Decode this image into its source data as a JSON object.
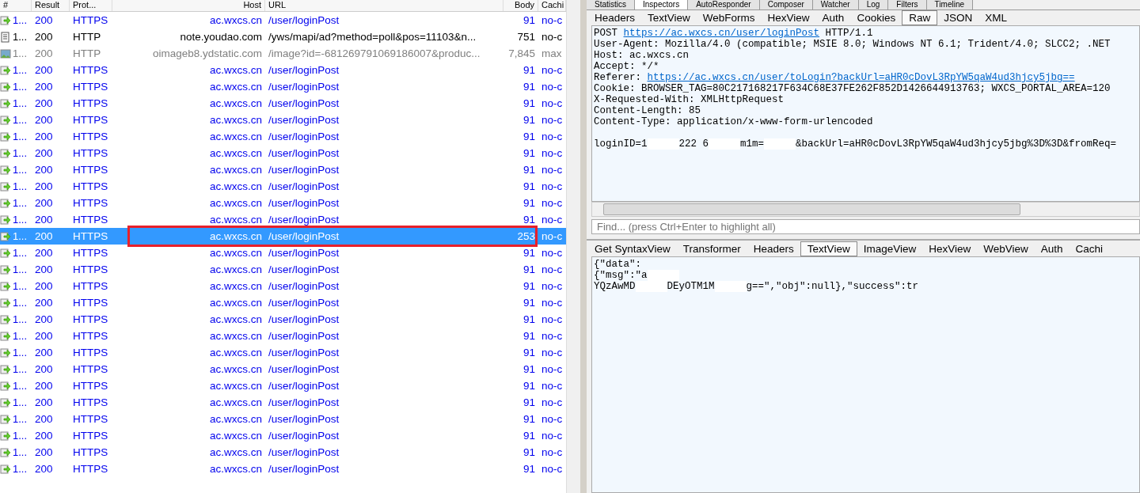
{
  "sessions": {
    "columns": [
      "#",
      "Result",
      "Prot...",
      "Host",
      "URL",
      "Body",
      "Cachi"
    ],
    "rows": [
      {
        "kind": "https",
        "num": "1...",
        "result": "200",
        "protocol": "HTTPS",
        "host": "ac.wxcs.cn",
        "url": "/user/loginPost",
        "body": "91",
        "caching": "no-c",
        "selected": false
      },
      {
        "kind": "html",
        "num": "1...",
        "result": "200",
        "protocol": "HTTP",
        "host": "note.youdao.com",
        "url": "/yws/mapi/ad?method=poll&pos=11103&n...",
        "body": "751",
        "caching": "no-c",
        "selected": false
      },
      {
        "kind": "image",
        "num": "1...",
        "result": "200",
        "protocol": "HTTP",
        "host": "oimageb8.ydstatic.com",
        "url": "/image?id=-681269791069186007&produc...",
        "body": "7,845",
        "caching": "max",
        "selected": false
      },
      {
        "kind": "https",
        "num": "1...",
        "result": "200",
        "protocol": "HTTPS",
        "host": "ac.wxcs.cn",
        "url": "/user/loginPost",
        "body": "91",
        "caching": "no-c",
        "selected": false
      },
      {
        "kind": "https",
        "num": "1...",
        "result": "200",
        "protocol": "HTTPS",
        "host": "ac.wxcs.cn",
        "url": "/user/loginPost",
        "body": "91",
        "caching": "no-c",
        "selected": false
      },
      {
        "kind": "https",
        "num": "1...",
        "result": "200",
        "protocol": "HTTPS",
        "host": "ac.wxcs.cn",
        "url": "/user/loginPost",
        "body": "91",
        "caching": "no-c",
        "selected": false
      },
      {
        "kind": "https",
        "num": "1...",
        "result": "200",
        "protocol": "HTTPS",
        "host": "ac.wxcs.cn",
        "url": "/user/loginPost",
        "body": "91",
        "caching": "no-c",
        "selected": false
      },
      {
        "kind": "https",
        "num": "1...",
        "result": "200",
        "protocol": "HTTPS",
        "host": "ac.wxcs.cn",
        "url": "/user/loginPost",
        "body": "91",
        "caching": "no-c",
        "selected": false
      },
      {
        "kind": "https",
        "num": "1...",
        "result": "200",
        "protocol": "HTTPS",
        "host": "ac.wxcs.cn",
        "url": "/user/loginPost",
        "body": "91",
        "caching": "no-c",
        "selected": false
      },
      {
        "kind": "https",
        "num": "1...",
        "result": "200",
        "protocol": "HTTPS",
        "host": "ac.wxcs.cn",
        "url": "/user/loginPost",
        "body": "91",
        "caching": "no-c",
        "selected": false
      },
      {
        "kind": "https",
        "num": "1...",
        "result": "200",
        "protocol": "HTTPS",
        "host": "ac.wxcs.cn",
        "url": "/user/loginPost",
        "body": "91",
        "caching": "no-c",
        "selected": false
      },
      {
        "kind": "https",
        "num": "1...",
        "result": "200",
        "protocol": "HTTPS",
        "host": "ac.wxcs.cn",
        "url": "/user/loginPost",
        "body": "91",
        "caching": "no-c",
        "selected": false
      },
      {
        "kind": "https",
        "num": "1...",
        "result": "200",
        "protocol": "HTTPS",
        "host": "ac.wxcs.cn",
        "url": "/user/loginPost",
        "body": "91",
        "caching": "no-c",
        "selected": false
      },
      {
        "kind": "https",
        "num": "1...",
        "result": "200",
        "protocol": "HTTPS",
        "host": "ac.wxcs.cn",
        "url": "/user/loginPost",
        "body": "253",
        "caching": "no-c",
        "selected": true
      },
      {
        "kind": "https",
        "num": "1...",
        "result": "200",
        "protocol": "HTTPS",
        "host": "ac.wxcs.cn",
        "url": "/user/loginPost",
        "body": "91",
        "caching": "no-c",
        "selected": false
      },
      {
        "kind": "https",
        "num": "1...",
        "result": "200",
        "protocol": "HTTPS",
        "host": "ac.wxcs.cn",
        "url": "/user/loginPost",
        "body": "91",
        "caching": "no-c",
        "selected": false
      },
      {
        "kind": "https",
        "num": "1...",
        "result": "200",
        "protocol": "HTTPS",
        "host": "ac.wxcs.cn",
        "url": "/user/loginPost",
        "body": "91",
        "caching": "no-c",
        "selected": false
      },
      {
        "kind": "https",
        "num": "1...",
        "result": "200",
        "protocol": "HTTPS",
        "host": "ac.wxcs.cn",
        "url": "/user/loginPost",
        "body": "91",
        "caching": "no-c",
        "selected": false
      },
      {
        "kind": "https",
        "num": "1...",
        "result": "200",
        "protocol": "HTTPS",
        "host": "ac.wxcs.cn",
        "url": "/user/loginPost",
        "body": "91",
        "caching": "no-c",
        "selected": false
      },
      {
        "kind": "https",
        "num": "1...",
        "result": "200",
        "protocol": "HTTPS",
        "host": "ac.wxcs.cn",
        "url": "/user/loginPost",
        "body": "91",
        "caching": "no-c",
        "selected": false
      },
      {
        "kind": "https",
        "num": "1...",
        "result": "200",
        "protocol": "HTTPS",
        "host": "ac.wxcs.cn",
        "url": "/user/loginPost",
        "body": "91",
        "caching": "no-c",
        "selected": false
      },
      {
        "kind": "https",
        "num": "1...",
        "result": "200",
        "protocol": "HTTPS",
        "host": "ac.wxcs.cn",
        "url": "/user/loginPost",
        "body": "91",
        "caching": "no-c",
        "selected": false
      },
      {
        "kind": "https",
        "num": "1...",
        "result": "200",
        "protocol": "HTTPS",
        "host": "ac.wxcs.cn",
        "url": "/user/loginPost",
        "body": "91",
        "caching": "no-c",
        "selected": false
      },
      {
        "kind": "https",
        "num": "1...",
        "result": "200",
        "protocol": "HTTPS",
        "host": "ac.wxcs.cn",
        "url": "/user/loginPost",
        "body": "91",
        "caching": "no-c",
        "selected": false
      },
      {
        "kind": "https",
        "num": "1...",
        "result": "200",
        "protocol": "HTTPS",
        "host": "ac.wxcs.cn",
        "url": "/user/loginPost",
        "body": "91",
        "caching": "no-c",
        "selected": false
      },
      {
        "kind": "https",
        "num": "1...",
        "result": "200",
        "protocol": "HTTPS",
        "host": "ac.wxcs.cn",
        "url": "/user/loginPost",
        "body": "91",
        "caching": "no-c",
        "selected": false
      },
      {
        "kind": "https",
        "num": "1...",
        "result": "200",
        "protocol": "HTTPS",
        "host": "ac.wxcs.cn",
        "url": "/user/loginPost",
        "body": "91",
        "caching": "no-c",
        "selected": false
      },
      {
        "kind": "https",
        "num": "1...",
        "result": "200",
        "protocol": "HTTPS",
        "host": "ac.wxcs.cn",
        "url": "/user/loginPost",
        "body": "91",
        "caching": "no-c",
        "selected": false
      }
    ]
  },
  "main_tabs": [
    {
      "label": "Statistics",
      "selected": false
    },
    {
      "label": "Inspectors",
      "selected": true
    },
    {
      "label": "AutoResponder",
      "selected": false
    },
    {
      "label": "Composer",
      "selected": false
    },
    {
      "label": "Watcher",
      "selected": false
    },
    {
      "label": "Log",
      "selected": false
    },
    {
      "label": "Filters",
      "selected": false
    },
    {
      "label": "Timeline",
      "selected": false
    }
  ],
  "request": {
    "tabs": [
      {
        "label": "Headers",
        "selected": false
      },
      {
        "label": "TextView",
        "selected": false
      },
      {
        "label": "WebForms",
        "selected": false
      },
      {
        "label": "HexView",
        "selected": false
      },
      {
        "label": "Auth",
        "selected": false
      },
      {
        "label": "Cookies",
        "selected": false
      },
      {
        "label": "Raw",
        "selected": true
      },
      {
        "label": "JSON",
        "selected": false
      },
      {
        "label": "XML",
        "selected": false
      }
    ],
    "lines": [
      [
        {
          "kind": "text",
          "text": "POST "
        },
        {
          "kind": "link",
          "text": "https://ac.wxcs.cn/user/loginPost"
        },
        {
          "kind": "text",
          "text": " HTTP/1.1"
        }
      ],
      [
        {
          "kind": "text",
          "text": "User-Agent: Mozilla/4.0 (compatible; MSIE 8.0; Windows NT 6.1; Trident/4.0; SLCC2; .NET"
        }
      ],
      [
        {
          "kind": "text",
          "text": "Host: ac.wxcs.cn"
        }
      ],
      [
        {
          "kind": "text",
          "text": "Accept: */*"
        }
      ],
      [
        {
          "kind": "text",
          "text": "Referer: "
        },
        {
          "kind": "link",
          "text": "https://ac.wxcs.cn/user/toLogin?backUrl=aHR0cDovL3RpYW5qaW4ud3hjcy5jbg=="
        }
      ],
      [
        {
          "kind": "text",
          "text": "Cookie: BROWSER_TAG=80C217168217F634C68E37FE262F852D1426644913763; WXCS_PORTAL_AREA=120"
        }
      ],
      [
        {
          "kind": "text",
          "text": "X-Requested-With: XMLHttpRequest"
        }
      ],
      [
        {
          "kind": "text",
          "text": "Content-Length: 85"
        }
      ],
      [
        {
          "kind": "text",
          "text": "Content-Type: application/x-www-form-urlencoded"
        }
      ],
      [
        {
          "kind": "gap"
        },
        {
          "kind": "text",
          "text": "loginID=1"
        },
        {
          "kind": "redacted"
        },
        {
          "kind": "text",
          "text": "222 6"
        },
        {
          "kind": "redacted"
        },
        {
          "kind": "text",
          "text": "m1m="
        },
        {
          "kind": "redacted"
        },
        {
          "kind": "text",
          "text": "&backUrl=aHR0cDovL3RpYW5qaW4ud3hjcy5jbg%3D%3D&fromReq="
        }
      ]
    ],
    "find_placeholder": "Find... (press Ctrl+Enter to highlight all)"
  },
  "response": {
    "tabs": [
      {
        "label": "Get SyntaxView",
        "selected": false
      },
      {
        "label": "Transformer",
        "selected": false
      },
      {
        "label": "Headers",
        "selected": false
      },
      {
        "label": "TextView",
        "selected": true
      },
      {
        "label": "ImageView",
        "selected": false
      },
      {
        "label": "HexView",
        "selected": false
      },
      {
        "label": "WebView",
        "selected": false
      },
      {
        "label": "Auth",
        "selected": false
      },
      {
        "label": "Cachi",
        "selected": false
      }
    ],
    "lines": [
      [
        {
          "kind": "text",
          "text": "{\"data\":"
        }
      ],
      [
        {
          "kind": "text",
          "text": "{\"msg\":\"a"
        },
        {
          "kind": "redacted"
        }
      ],
      [
        {
          "kind": "text",
          "text": "YQzAwMD"
        },
        {
          "kind": "redacted"
        },
        {
          "kind": "text",
          "text": "DEyOTM1M"
        },
        {
          "kind": "redacted"
        },
        {
          "kind": "text",
          "text": "g==\",\"obj\":null},\"success\":tr"
        }
      ]
    ]
  }
}
